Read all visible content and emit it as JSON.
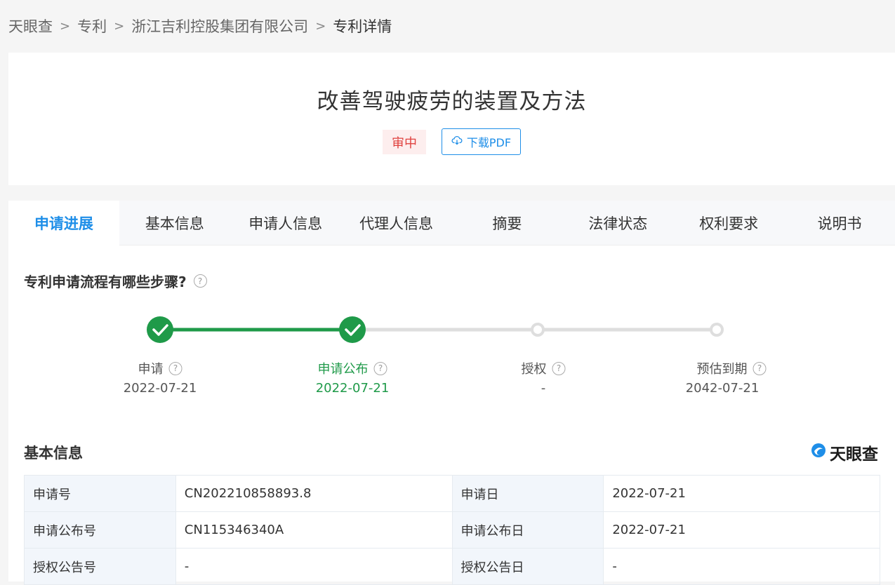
{
  "breadcrumb": {
    "items": [
      "天眼查",
      "专利",
      "浙江吉利控股集团有限公司"
    ],
    "current": "专利详情"
  },
  "patent": {
    "title": "改善驾驶疲劳的装置及方法",
    "status": "审中",
    "download_label": "下载PDF"
  },
  "tabs": [
    "申请进展",
    "基本信息",
    "申请人信息",
    "代理人信息",
    "摘要",
    "法律状态",
    "权利要求",
    "说明书"
  ],
  "process": {
    "question": "专利申请流程有哪些步骤?",
    "steps": [
      {
        "label": "申请",
        "date": "2022-07-21",
        "done": true
      },
      {
        "label": "申请公布",
        "date": "2022-07-21",
        "done": true
      },
      {
        "label": "授权",
        "date": "-",
        "done": false
      },
      {
        "label": "预估到期",
        "date": "2042-07-21",
        "done": false
      }
    ]
  },
  "basic_info": {
    "title": "基本信息",
    "brand": "天眼查",
    "rows": [
      {
        "k1": "申请号",
        "v1": "CN202210858893.8",
        "k2": "申请日",
        "v2": "2022-07-21"
      },
      {
        "k1": "申请公布号",
        "v1": "CN115346340A",
        "k2": "申请公布日",
        "v2": "2022-07-21"
      },
      {
        "k1": "授权公告号",
        "v1": "-",
        "k2": "授权公告日",
        "v2": "-"
      }
    ]
  },
  "colors": {
    "accent": "#1e8ee8",
    "success": "#1f9a49",
    "danger": "#e0413f"
  }
}
